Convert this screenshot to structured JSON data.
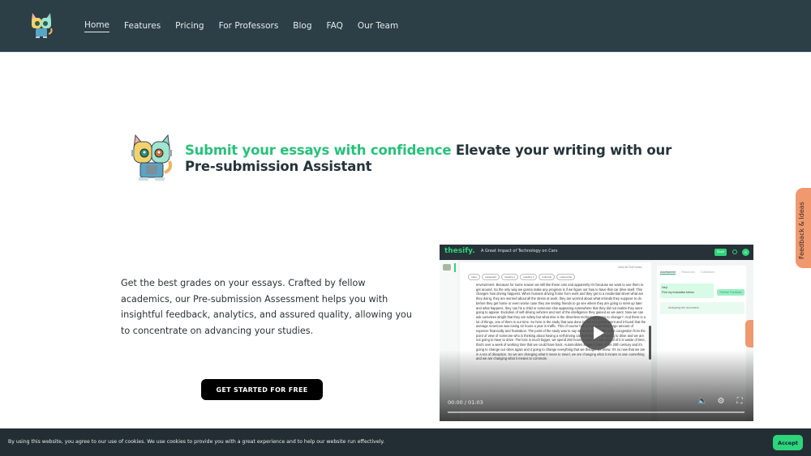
{
  "header": {
    "logo_alt": "thesify mascot",
    "nav": [
      {
        "label": "Home",
        "active": true
      },
      {
        "label": "Features"
      },
      {
        "label": "Pricing"
      },
      {
        "label": "For Professors"
      },
      {
        "label": "Blog"
      },
      {
        "label": "FAQ"
      },
      {
        "label": "Our Team"
      }
    ]
  },
  "hero": {
    "title_highlight": "Submit your essays with confidence",
    "title_rest": " Elevate your writing with our Pre-submission Assistant",
    "description": "Get the best grades on your essays. Crafted by fellow academics, our Pre-submission Assessment helps you with insightful feedback, analytics, and assured quality, allowing you to concentrate on advancing your studies.",
    "cta_label": "GET STARTED FOR FREE"
  },
  "video": {
    "brand": "thesify.",
    "doc_title": "A Great Impact of Technology on Cars",
    "share_label": "Share",
    "avatar_initial": "S",
    "editor_tools": "View all  Text  Notes",
    "chips": [
      "Index",
      "paragraph",
      "heading 1",
      "heading 2",
      "bullet list",
      "ordered list"
    ],
    "text": "environment. Because for some reason we still like these cars and apparently it's because we want to use them to get around. So the only way we gonna make any progress is if we figure out how to have that car drive itself. This changes how driving happens. When humans driving home from work and they get to a residential street what are they doing, they are worried about all the stress at work, they are worried about what errands they suppose to do before they get home or even worse case they are texting friends to go see where they are going to meet up later and what happens, they can hit a child or someone else appearing somewhere that they did not realize they were going to appear. Evolution of self-driving vehicles and sort of the intelligence they gained as we went. Now we can ask ourselves alright that they are safety but what else is the driverless technology going to change?. And there is a lot of things, one of them is our time. So here is the study that was done by the US government and it found that the average American was losing 42 hours a year in traffic. This of course has a corresponding large amount of expense financially and frustration. The point of the study was to say what we can do about the congestion from the point of view of someone who is thinking about having a self-driving car that they are not going to drive and we are not going to have to drive. The loss is much bigger, we spend 293 hours a year in a car and all of it is waste of time, that's over a week of working time that we could have back. Automobiles shaped cities of the 20th century and it's going to change our cities again and it going to change everything that we thought we knew. It's no new that we are in a era of disruption. So we are changing what it mean to travel, we are changing what it means to own something and we are changing what it means to commute.",
    "panel_tabs": [
      "Assessment",
      "Resources",
      "Collections"
    ],
    "bubble_line1": "Hey!",
    "bubble_line2": "Find my evaluation below.",
    "refresh_label": "Refresh Feedback",
    "analyzing": "Analyzing the document...",
    "time": "00:00 / 01:03",
    "progress": 0
  },
  "feedback_tab": "Feedback & Ideas",
  "cookie": {
    "text": "By using this website, you agree to our use of cookies. We use cookies to provide you with a great experience and to help our website run effectively.",
    "accept_label": "Accept"
  }
}
